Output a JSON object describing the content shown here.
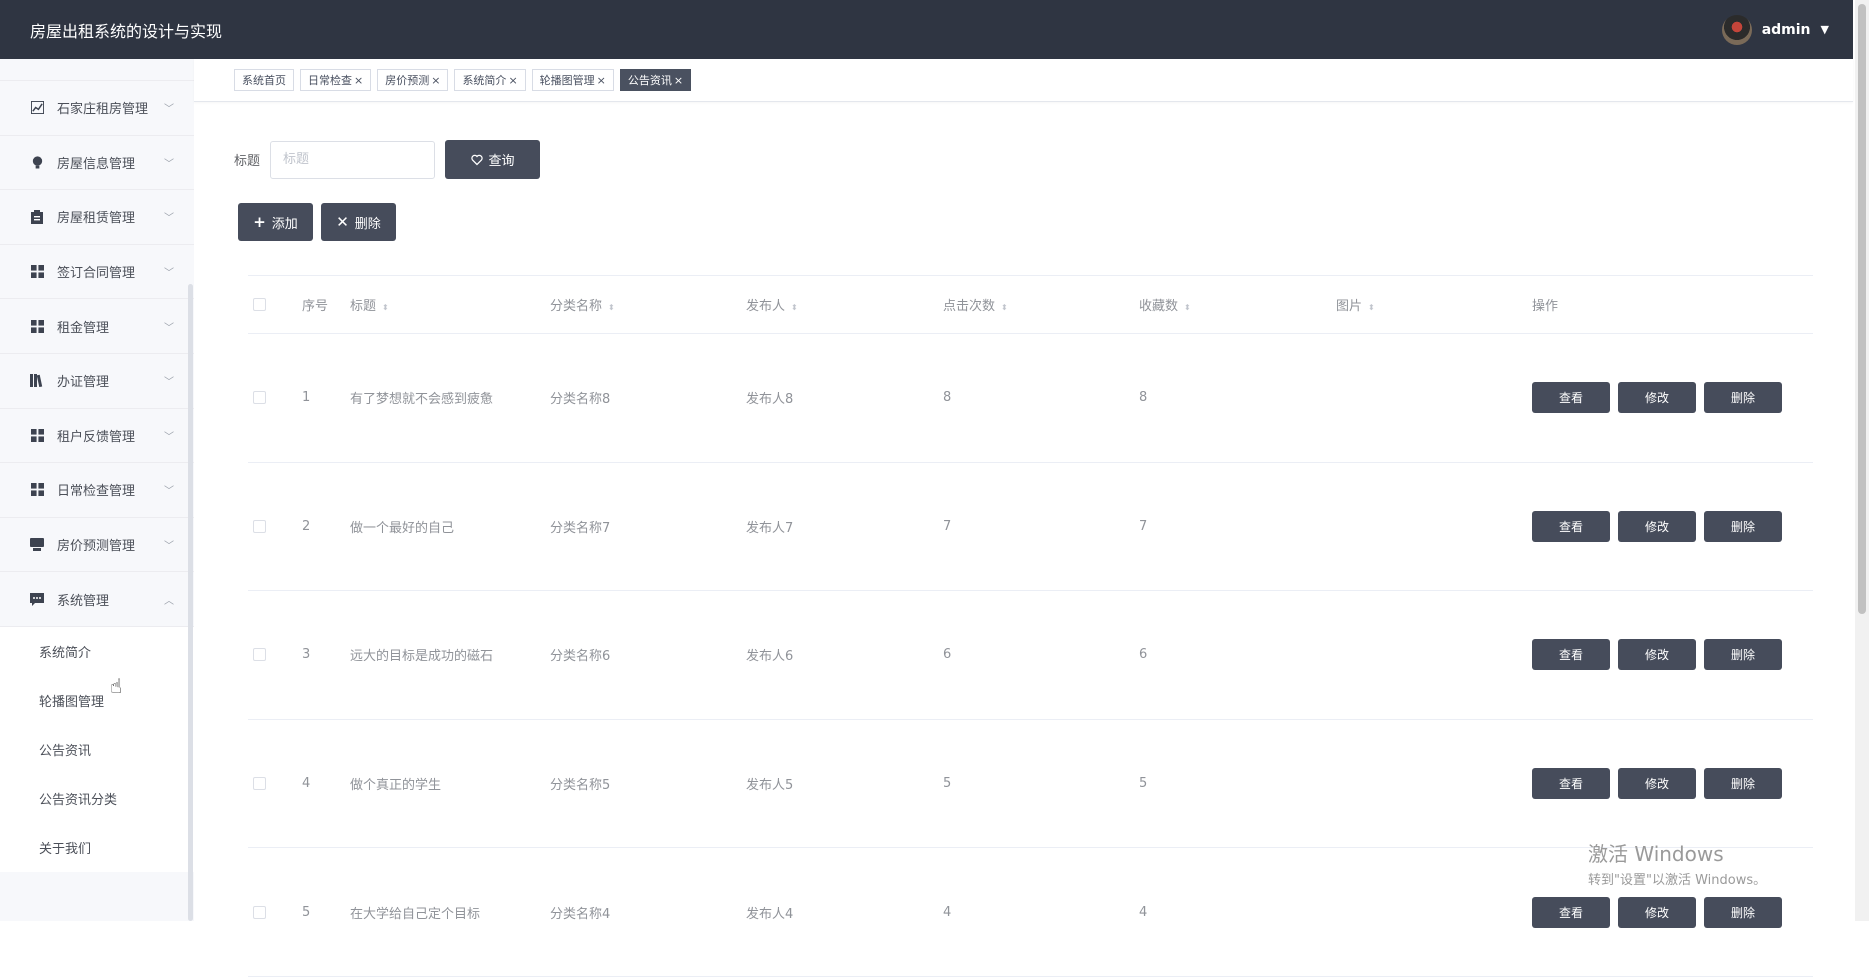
{
  "app": {
    "title": "房屋出租系统的设计与实现"
  },
  "user": {
    "name": "admin",
    "caret": "▼"
  },
  "sidebar": {
    "items": [
      {
        "label": "石家庄租房管理",
        "icon": "chart-icon",
        "chevron": "﹀"
      },
      {
        "label": "房屋信息管理",
        "icon": "lightbulb-icon",
        "chevron": "﹀"
      },
      {
        "label": "房屋租赁管理",
        "icon": "clipboard-icon",
        "chevron": "﹀"
      },
      {
        "label": "签订合同管理",
        "icon": "grid-icon",
        "chevron": "﹀"
      },
      {
        "label": "租金管理",
        "icon": "grid-icon",
        "chevron": "﹀"
      },
      {
        "label": "办证管理",
        "icon": "book-icon",
        "chevron": "﹀"
      },
      {
        "label": "租户反馈管理",
        "icon": "grid-icon",
        "chevron": "﹀"
      },
      {
        "label": "日常检查管理",
        "icon": "grid-icon",
        "chevron": "﹀"
      },
      {
        "label": "房价预测管理",
        "icon": "inbox-icon",
        "chevron": "﹀"
      },
      {
        "label": "系统管理",
        "icon": "chat-icon",
        "chevron": "︿"
      }
    ],
    "sub_items": [
      "系统简介",
      "轮播图管理",
      "公告资讯",
      "公告资讯分类",
      "关于我们"
    ]
  },
  "tabs": [
    {
      "label": "系统首页",
      "closable": false,
      "active": false
    },
    {
      "label": "日常检查",
      "closable": true,
      "active": false
    },
    {
      "label": "房价预测",
      "closable": true,
      "active": false
    },
    {
      "label": "系统简介",
      "closable": true,
      "active": false
    },
    {
      "label": "轮播图管理",
      "closable": true,
      "active": false
    },
    {
      "label": "公告资讯",
      "closable": true,
      "active": true
    }
  ],
  "close_symbol": "×",
  "search": {
    "label": "标题",
    "placeholder": "标题",
    "button_label": "查询"
  },
  "actions": {
    "add_label": "添加",
    "delete_label": "删除"
  },
  "table": {
    "columns": [
      "序号",
      "标题",
      "分类名称",
      "发布人",
      "点击次数",
      "收藏数",
      "图片",
      "操作"
    ],
    "sort_symbol": "⬍",
    "rows": [
      {
        "idx": "1",
        "title": "有了梦想就不会感到疲惫",
        "category": "分类名称8",
        "publisher": "发布人8",
        "clicks": "8",
        "favorites": "8"
      },
      {
        "idx": "2",
        "title": "做一个最好的自己",
        "category": "分类名称7",
        "publisher": "发布人7",
        "clicks": "7",
        "favorites": "7"
      },
      {
        "idx": "3",
        "title": "远大的目标是成功的磁石",
        "category": "分类名称6",
        "publisher": "发布人6",
        "clicks": "6",
        "favorites": "6"
      },
      {
        "idx": "4",
        "title": "做个真正的学生",
        "category": "分类名称5",
        "publisher": "发布人5",
        "clicks": "5",
        "favorites": "5"
      },
      {
        "idx": "5",
        "title": "在大学给自己定个目标",
        "category": "分类名称4",
        "publisher": "发布人4",
        "clicks": "4",
        "favorites": "4"
      }
    ],
    "row_actions": {
      "view": "查看",
      "edit": "修改",
      "delete": "删除"
    }
  },
  "watermark": {
    "line1": "激活 Windows",
    "line2": "转到\"设置\"以激活 Windows。"
  },
  "colors": {
    "topbar": "#2f3542",
    "button": "#464c5b",
    "active_tab": "#4a5160"
  }
}
